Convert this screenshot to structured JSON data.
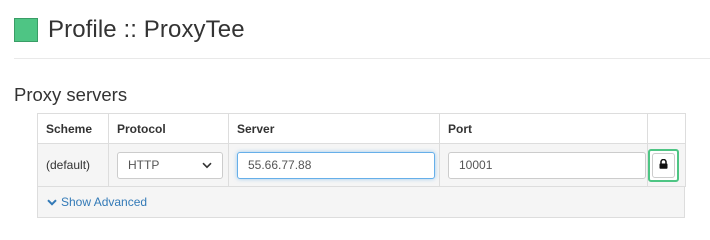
{
  "header": {
    "title": "Profile :: ProxyTee",
    "accent_color": "#4ec584"
  },
  "section": {
    "title": "Proxy servers"
  },
  "table": {
    "columns": [
      "Scheme",
      "Protocol",
      "Server",
      "Port",
      ""
    ],
    "rows": [
      {
        "scheme": "(default)",
        "protocol": "HTTP",
        "server": "55.66.77.88",
        "port": "10001",
        "lock_icon": "lock-icon"
      }
    ]
  },
  "advanced": {
    "label": "Show Advanced",
    "icon": "chevron-down-icon",
    "link_color": "#337ab7"
  }
}
